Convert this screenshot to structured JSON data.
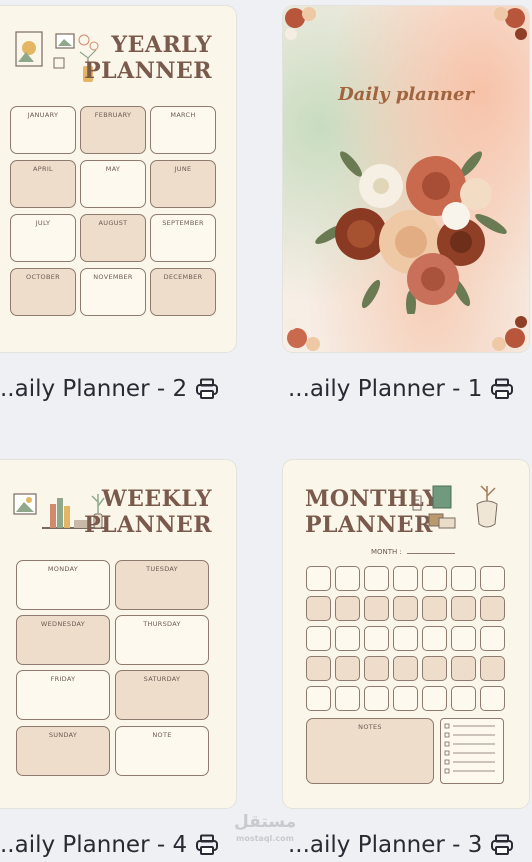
{
  "cards": [
    {
      "caption": "..aily Planner - 2",
      "title_line1": "YEARLY",
      "title_line2": "PLANNER",
      "months": [
        "JANUARY",
        "FEBRUARY",
        "MARCH",
        "APRIL",
        "MAY",
        "JUNE",
        "JULY",
        "AUGUST",
        "SEPTEMBER",
        "OCTOBER",
        "NOVEMBER",
        "DECEMBER"
      ]
    },
    {
      "caption": "...aily Planner - 1",
      "title": "Daily planner"
    },
    {
      "caption": "..aily Planner - 4",
      "title_line1": "WEEKLY",
      "title_line2": "PLANNER",
      "days": [
        "MONDAY",
        "TUESDAY",
        "WEDNESDAY",
        "THURSDAY",
        "FRIDAY",
        "SATURDAY",
        "SUNDAY",
        "NOTE"
      ]
    },
    {
      "caption": "...aily Planner - 3",
      "title_line1": "MONTHLY",
      "title_line2": "PLANNER",
      "month_label": "MONTH :",
      "notes_label": "NOTES"
    }
  ],
  "watermark": {
    "arabic": "مستقل",
    "latin": "mostaql.com"
  },
  "icons": {
    "print": "printer-icon"
  },
  "colors": {
    "card": "#fbf6ea",
    "tan": "#eeddcb",
    "title": "#7a5a4c",
    "background": "#eef0f4"
  }
}
